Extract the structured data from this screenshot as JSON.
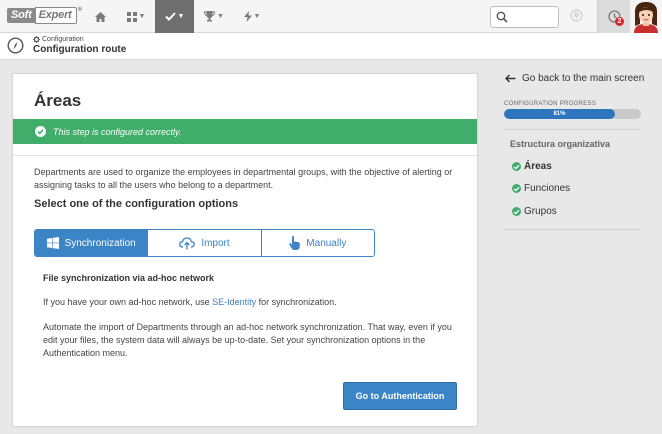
{
  "topbar": {
    "logo_part1": "Soft",
    "logo_part2": "Expert",
    "logo_reg": "®",
    "notification_count": "2"
  },
  "breadcrumb": {
    "small": "Configuration",
    "title": "Configuration route"
  },
  "card": {
    "title": "Áreas",
    "success_message": "This step is configured correctly.",
    "description": "Departments are used to organize the employees in departmental groups, with the objective of alerting or assigning tasks to all the users who belong to a department.",
    "options_title": "Select one of the configuration options",
    "tabs": [
      {
        "label": "Synchronization",
        "icon": "windows-icon",
        "active": true
      },
      {
        "label": "Import",
        "icon": "cloud-upload-icon",
        "active": false
      },
      {
        "label": "Manually",
        "icon": "hand-pointer-icon",
        "active": false
      }
    ],
    "sync_title": "File synchronization via ad-hoc network",
    "p1_before": "If you have your own ad-hoc network, use ",
    "p1_link": "SE-Identity",
    "p1_after": " for synchronization.",
    "p2": "Automate the import of Departments through an ad-hoc network synchronization. That way, even if you edit your files, the system data will always be up-to-date. Set your synchronization options in the Authentication menu.",
    "button_label": "Go to Authentication"
  },
  "side": {
    "back_label": "Go back to the main screen",
    "progress_label": "CONFIGURATION PROGRESS",
    "progress_value": 81,
    "progress_text": "81%",
    "section_title": "Estructura organizativa",
    "steps": [
      {
        "label": "Áreas",
        "current": true
      },
      {
        "label": "Funciones",
        "current": false
      },
      {
        "label": "Grupos",
        "current": false
      }
    ]
  },
  "colors": {
    "accent": "#3b84c6",
    "success": "#41ad6b",
    "progress": "#2d75bd"
  }
}
